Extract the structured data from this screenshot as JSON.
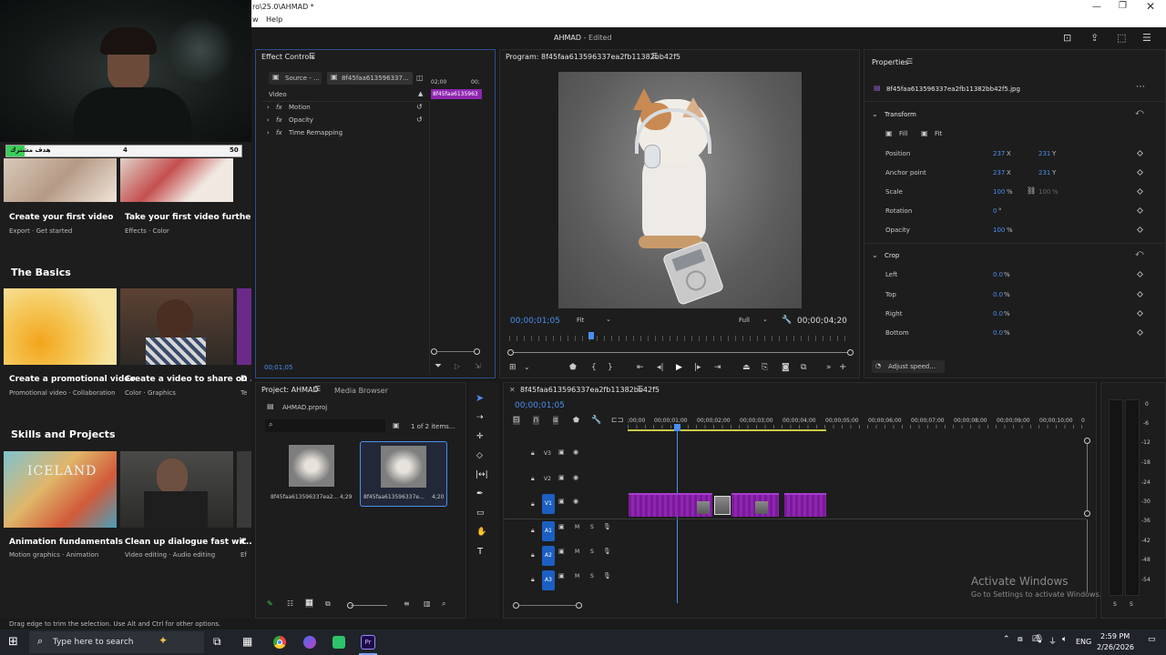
{
  "window": {
    "path": "ro\\25.0\\AHMAD *",
    "menu_fragment": "w",
    "menu_help": "Help",
    "title": "AHMAD",
    "status": "- Edited"
  },
  "learn": {
    "goal_label": "هدف مشترك",
    "goal_current": "4",
    "goal_target": "50",
    "cards_top": [
      {
        "title": "Create your first video",
        "sub": "Export  ·  Get started"
      },
      {
        "title": "Take your first video further",
        "sub": "Effects  ·  Color"
      }
    ],
    "section_basics": "The Basics",
    "cards_basics": [
      {
        "title": "Create a promotional video",
        "sub": "Promotional video  ·  Collaboration"
      },
      {
        "title": "Create a video to share on ...",
        "sub": "Color  ·  Graphics"
      },
      {
        "title": "D",
        "sub": "Te"
      }
    ],
    "section_skills": "Skills and Projects",
    "iceland_text": "ICELAND",
    "cards_skills": [
      {
        "title": "Animation fundamentals",
        "sub": "Motion graphics  ·  Animation"
      },
      {
        "title": "Clean up dialogue fast wit...",
        "sub": "Video editing  ·  Audio editing"
      },
      {
        "title": "C",
        "sub": "Ef"
      }
    ]
  },
  "effect_controls": {
    "title": "Effect Controls",
    "source_tab": "Source - ...",
    "clip_tab": "8f45faa613596337...",
    "ruler_a": "02;00",
    "ruler_b": "00;",
    "clip_label": "8f45faa6135963",
    "video_label": "Video",
    "effects": [
      "Motion",
      "Opacity",
      "Time Remapping"
    ],
    "timecode": "00;01;05"
  },
  "program": {
    "title": "Program: 8f45faa613596337ea2fb11382bb42f5",
    "timecode": "00;00;01;05",
    "fit": "Fit",
    "quality": "Full",
    "duration": "00;00;04;20"
  },
  "properties": {
    "title": "Properties",
    "file": "8f45faa613596337ea2fb11382bb42f5.jpg",
    "transform": "Transform",
    "fill": "Fill",
    "fit": "Fit",
    "rows": [
      {
        "label": "Position",
        "v1": "237",
        "u1": "X",
        "v2": "231",
        "u2": "Y"
      },
      {
        "label": "Anchor point",
        "v1": "237",
        "u1": "X",
        "v2": "231",
        "u2": "Y"
      },
      {
        "label": "Scale",
        "v1": "100",
        "u1": "%",
        "v2": "100",
        "u2": "%"
      },
      {
        "label": "Rotation",
        "v1": "0",
        "u1": "°",
        "v2": "",
        "u2": ""
      },
      {
        "label": "Opacity",
        "v1": "100",
        "u1": "%",
        "v2": "",
        "u2": ""
      }
    ],
    "crop": "Crop",
    "crop_rows": [
      {
        "label": "Left",
        "v": "0.0",
        "u": "%"
      },
      {
        "label": "Top",
        "v": "0.0",
        "u": "%"
      },
      {
        "label": "Right",
        "v": "0.0",
        "u": "%"
      },
      {
        "label": "Bottom",
        "v": "0.0",
        "u": "%"
      }
    ],
    "adjust_speed": "Adjust speed..."
  },
  "project": {
    "tab": "Project: AHMAD",
    "tab2": "Media Browser",
    "file": "AHMAD.prproj",
    "count": "1 of 2 items...",
    "items": [
      {
        "name": "8f45faa613596337ea2...",
        "dur": "4;29"
      },
      {
        "name": "8f45faa613596337e...",
        "dur": "4;20"
      }
    ]
  },
  "timeline": {
    "title": "8f45faa613596337ea2fb11382bb42f5",
    "timecode": "00;00;01;05",
    "ruler": [
      ";00;00",
      "00;00;01;00",
      "00;00;02;00",
      "00;00;03;00",
      "00;00;04;00",
      "00;00;05;00",
      "00;00;06;00",
      "00;00;07;00",
      "00;00;08;00",
      "00;00;09;00",
      "00;00;10;00",
      "0"
    ],
    "video_tracks": [
      "V3",
      "V2",
      "V1"
    ],
    "audio_tracks": [
      "A1",
      "A2",
      "A3"
    ],
    "m": "M",
    "s": "S"
  },
  "meter": {
    "ticks": [
      "0",
      "-6",
      "-12",
      "-18",
      "-24",
      "-30",
      "-36",
      "-42",
      "-48",
      "-54"
    ],
    "s": "S",
    "s2": "S"
  },
  "status_bar": "Drag edge to trim the selection. Use Alt and Ctrl for other options.",
  "watermark": {
    "line1": "Activate Windows",
    "line2": "Go to Settings to activate Windows."
  },
  "taskbar": {
    "search_placeholder": "Type here to search",
    "lang": "ENG",
    "time": "2:59 PM",
    "date": "2/26/2026"
  },
  "colors": {
    "accent": "#4b8ef0",
    "clip": "#8e26b0",
    "track": "#1b5fc2"
  }
}
